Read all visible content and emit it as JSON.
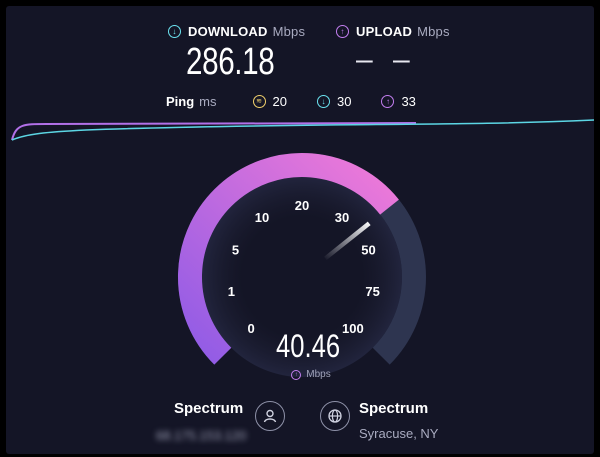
{
  "download": {
    "label": "DOWNLOAD",
    "unit": "Mbps",
    "value": "286.18",
    "icon": "download-arrow-icon"
  },
  "upload": {
    "label": "UPLOAD",
    "unit": "Mbps",
    "value": "– –",
    "icon": "upload-arrow-icon"
  },
  "ping": {
    "label": "Ping",
    "unit": "ms",
    "idle": "20",
    "download": "30",
    "upload": "33"
  },
  "gauge": {
    "ticks": [
      "0",
      "1",
      "5",
      "10",
      "20",
      "30",
      "50",
      "75",
      "100"
    ],
    "current_value": "40.46",
    "unit": "Mbps",
    "colors": {
      "active_start": "#8f5be6",
      "active_end": "#f07ad8",
      "inactive": "#2e3550"
    }
  },
  "client": {
    "provider": "Spectrum",
    "ip": "68.175.153.120",
    "icon": "person-icon"
  },
  "server": {
    "provider": "Spectrum",
    "location": "Syracuse, NY",
    "icon": "globe-icon"
  },
  "colors": {
    "background": "#141526",
    "download": "#6be3f0",
    "upload": "#c37ef0",
    "jitter": "#f1d06b"
  }
}
